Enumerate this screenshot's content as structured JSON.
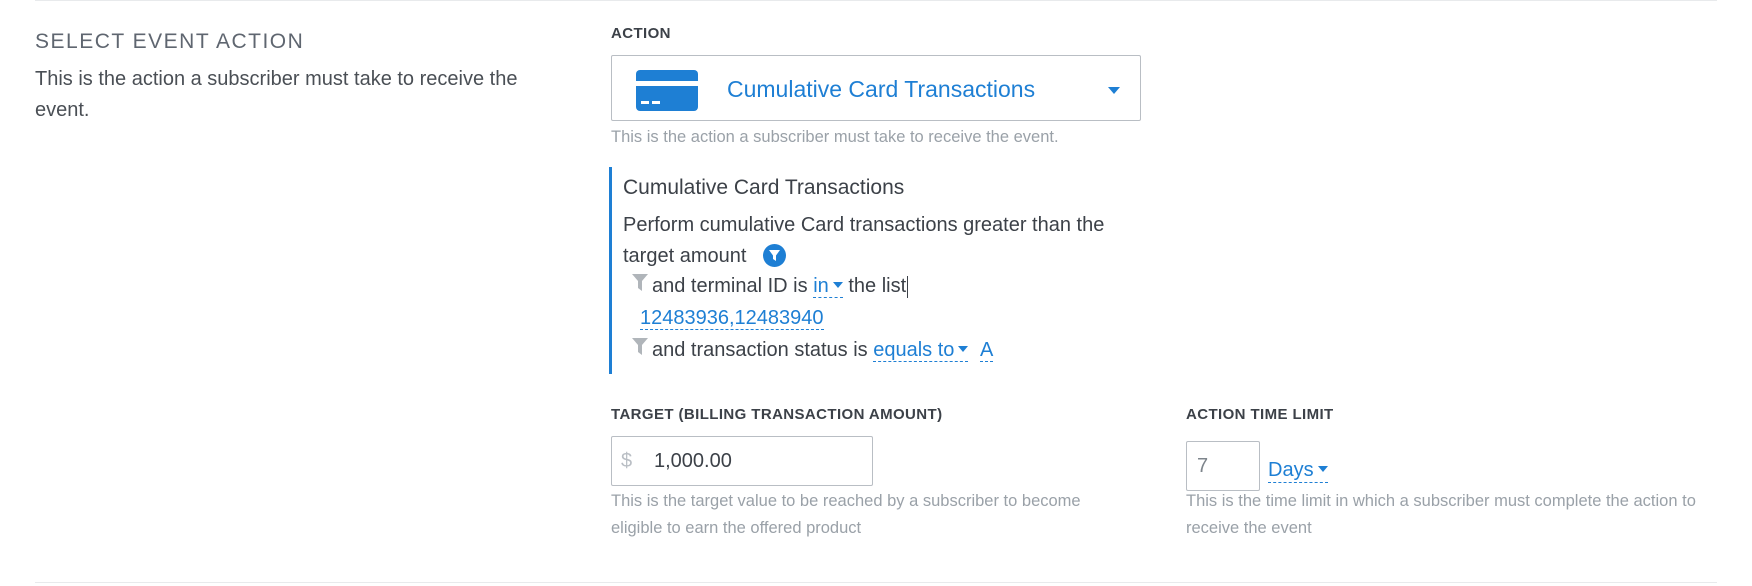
{
  "section": {
    "title": "SELECT EVENT ACTION",
    "description": "This is the action a subscriber must take to receive the event."
  },
  "action": {
    "label": "ACTION",
    "selected": "Cumulative Card Transactions",
    "icon": "credit-card-icon",
    "help": "This is the action a subscriber must take to receive the event."
  },
  "detail": {
    "title": "Cumulative Card Transactions",
    "description": "Perform cumulative Card transactions greater than the target amount",
    "conditions": {
      "terminal_prefix": "and terminal ID is",
      "terminal_operator": "in",
      "terminal_suffix": "the list",
      "terminal_values": "12483936,12483940",
      "status_prefix": "and transaction status is",
      "status_operator": "equals to",
      "status_value": "A"
    }
  },
  "target": {
    "label": "TARGET (BILLING TRANSACTION AMOUNT)",
    "currency": "$",
    "value": "1,000.00",
    "help": "This is the target value to be reached by a subscriber to become eligible to earn the offered product"
  },
  "time_limit": {
    "label": "ACTION TIME LIMIT",
    "value": "7",
    "unit": "Days",
    "help": "This is the time limit in which a subscriber must complete the action to receive the event"
  },
  "colors": {
    "accent": "#1e7fd4",
    "text": "#3c4148",
    "muted": "#9aa1a8",
    "border": "#b9bec4"
  }
}
